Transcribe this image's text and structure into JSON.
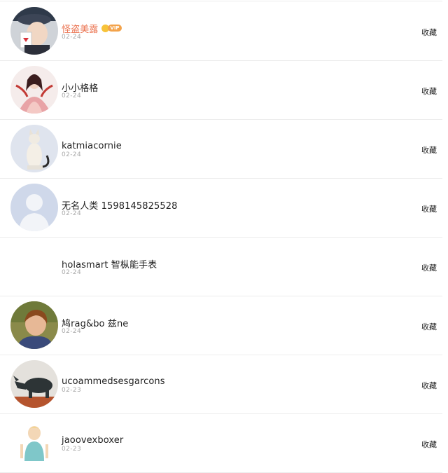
{
  "colors": {
    "divider": "#ececec",
    "vip_name": "#eb7350",
    "date": "#a8a8a8"
  },
  "users": [
    {
      "name": "怪盗美露",
      "date": "02-24",
      "vip": true,
      "vip_label": "VIP",
      "action": "收藏",
      "avatar": "anime-avatar"
    },
    {
      "name": "小小格格",
      "date": "02-24",
      "vip": false,
      "action": "收藏",
      "avatar": "costume-avatar"
    },
    {
      "name": "katmiacornie",
      "date": "02-24",
      "vip": false,
      "action": "收藏",
      "avatar": "cat-avatar"
    },
    {
      "name": "无名人类 1598145825528",
      "date": "02-24",
      "vip": false,
      "action": "收藏",
      "avatar": "default-avatar"
    },
    {
      "name": "holasmart 智枞能手表",
      "date": "02-24",
      "vip": false,
      "action": "收藏",
      "avatar": "blank-avatar"
    },
    {
      "name": "鸠rag&bo 兹ne",
      "date": "02-24",
      "vip": false,
      "action": "收藏",
      "avatar": "photo-avatar"
    },
    {
      "name": "ucoammedsesgarcons",
      "date": "02-23",
      "vip": false,
      "action": "收藏",
      "avatar": "rhino-avatar"
    },
    {
      "name": "jaoovexboxer",
      "date": "02-23",
      "vip": false,
      "action": "收藏",
      "avatar": "figure-avatar"
    }
  ]
}
